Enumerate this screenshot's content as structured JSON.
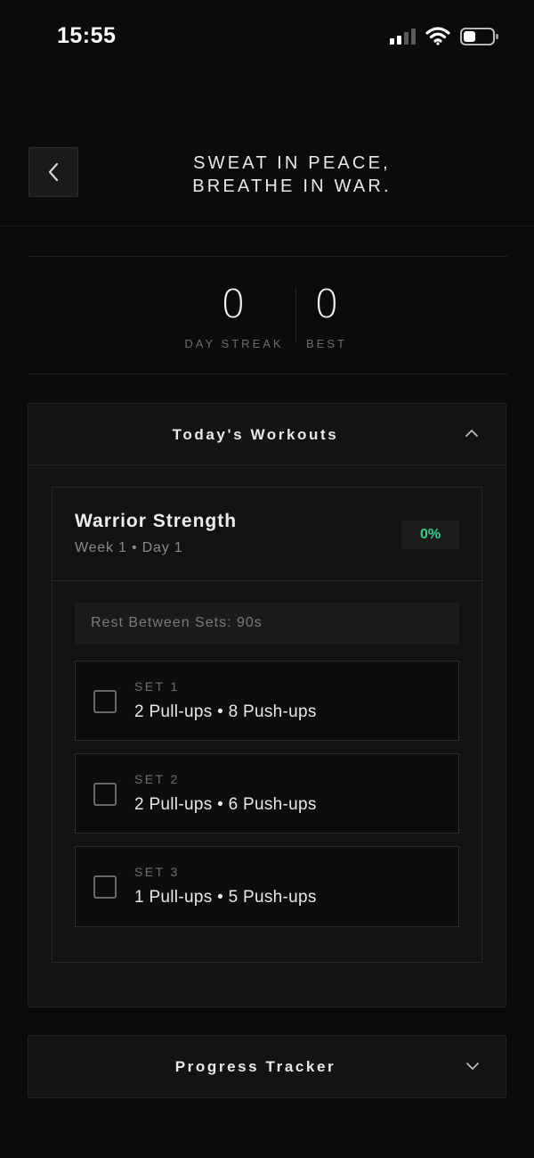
{
  "status_bar": {
    "time": "15:55",
    "icons": [
      "signal-icon",
      "wifi-icon",
      "battery-icon"
    ]
  },
  "header": {
    "back_icon": "chevron-left-icon",
    "title_line1": "SWEAT IN PEACE,",
    "title_line2": "BREATHE IN WAR."
  },
  "streak": {
    "day_streak_value": "0",
    "day_streak_label": "DAY STREAK",
    "best_value": "0",
    "best_label": "BEST"
  },
  "todays_workouts": {
    "title": "Today's Workouts",
    "expanded": true,
    "toggle_icon": "chevron-up-icon",
    "workout": {
      "name": "Warrior Strength",
      "subtitle": "Week 1 • Day 1",
      "progress_label": "0%",
      "progress_color": "#2fcf8f",
      "rest": "Rest Between Sets: 90s",
      "sets": [
        {
          "label": "SET 1",
          "detail": "2 Pull-ups • 8 Push-ups",
          "checked": false
        },
        {
          "label": "SET 2",
          "detail": "2 Pull-ups • 6 Push-ups",
          "checked": false
        },
        {
          "label": "SET 3",
          "detail": "1 Pull-ups • 5 Push-ups",
          "checked": false
        }
      ]
    }
  },
  "progress_tracker": {
    "title": "Progress Tracker",
    "expanded": false,
    "toggle_icon": "chevron-down-icon"
  }
}
